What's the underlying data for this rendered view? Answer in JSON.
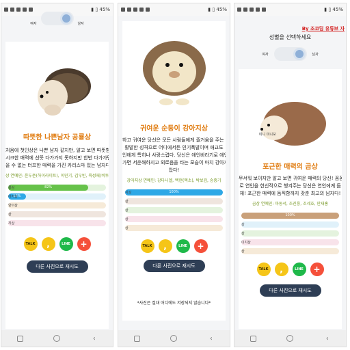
{
  "status": {
    "panel1_right": "▮ ▯ 45%",
    "panel2_right": "▮ ▯ 45%",
    "panel3_right": "▮ ▯ 45%"
  },
  "panel1": {
    "gender_left": "여자",
    "gender_right": "남자",
    "result_title": "따뜻한 나쁜남자 공룡상",
    "desc_lines": [
      "처음에 첫인상은 나쁜 남자 같지만, 알고 보면 따뜻함이",
      "시크한 매력에 선뜻 다가가지 못하지만 한번 다가가면",
      "을 수 없는 터프한 매력을 가진 카리스마 있는 남자다."
    ],
    "celeb": "상 연예인: 윤두준(하이라이트), 이민기, 김우빈, 육성재(비투비)...",
    "bars": [
      {
        "label": "룡상",
        "value": "82%",
        "percent": 82,
        "fill": "#66c24a",
        "track": "#e4f3de"
      },
      {
        "label": "아지상",
        "value": "18%",
        "percent": 18,
        "fill": "#2ea8e6",
        "track": "#e0f1fa"
      },
      {
        "label": "양이상",
        "value": "",
        "percent": 0,
        "fill": "#e0a65a",
        "track": "#f6ead8"
      },
      {
        "label": "상",
        "value": "",
        "percent": 0,
        "fill": "#c9a07a",
        "track": "#efe5de"
      },
      {
        "label": "끼상",
        "value": "",
        "percent": 0,
        "fill": "#e88aa5",
        "track": "#f8e3ea"
      }
    ],
    "share": {
      "kakao": "TALK",
      "comma": ",",
      "line": "LINE",
      "plus": "+"
    },
    "retry": "다른 사진으로 재시도"
  },
  "panel2": {
    "result_title": "귀여운 순둥이 강아지상",
    "desc_lines": [
      "하고 귀여운 당신은 모든 사람들에게 즐거움을 주는 3",
      "활발한 성격으로 어디에서든 인기폭발이며 애교도",
      "인에게 특히나 사랑스럽다. 당신은 애인바라기로 애인",
      "가면 서운해하지고 외로움을 타는 모습이 마치 강아지",
      "았다!"
    ],
    "celeb": "강아지상 연예인: 강다니엘, 백현(엑소), 박보검, 송중기",
    "bars": [
      {
        "label": "지상",
        "value": "100%",
        "percent": 100,
        "fill": "#2ea8e6",
        "track": "#e0f1fa"
      },
      {
        "label": "상",
        "value": "",
        "percent": 0,
        "fill": "#c9a07a",
        "track": "#efe5de"
      },
      {
        "label": "상",
        "value": "",
        "percent": 0,
        "fill": "#66c24a",
        "track": "#e4f3de"
      },
      {
        "label": "상",
        "value": "",
        "percent": 0,
        "fill": "#e88aa5",
        "track": "#f8e3ea"
      },
      {
        "label": "상",
        "value": "",
        "percent": 0,
        "fill": "#e0a65a",
        "track": "#f6ead8"
      }
    ],
    "share": {
      "kakao": "TALK",
      "comma": ",",
      "line": "LINE",
      "plus": "+"
    },
    "retry": "다른 사진으로 재시도",
    "disclaimer": "*사진은 절대 어디에도 저장되지 않습니다*"
  },
  "panel3": {
    "brand": "By 조코딩 유튜브 자",
    "gender_prompt": "성별을 선택하세요",
    "gender_left": "여자",
    "gender_right": "남자",
    "result_title": "포근한 매력의 곰상",
    "desc_lines": [
      "무서워 보이지만 알고 보면 귀여운 매력의 당신! 꼼꼼",
      "로 연인을 헌신적으로 챙겨주는 당신은 연인에게 듬",
      "재! 포근한 매력에 듬직함까지 갖춘 최고의 남자다!"
    ],
    "celeb": "곰상 연예인: 마동석, 조진웅, 조세호, 안재홍",
    "bars": [
      {
        "label": "",
        "value": "100%",
        "percent": 100,
        "fill": "#c9a07a",
        "track": "#efe5de"
      },
      {
        "label": "상",
        "value": "",
        "percent": 0,
        "fill": "#2ea8e6",
        "track": "#e0f1fa"
      },
      {
        "label": "상",
        "value": "",
        "percent": 0,
        "fill": "#66c24a",
        "track": "#e4f3de"
      },
      {
        "label": "이지상",
        "value": "",
        "percent": 0,
        "fill": "#e88aa5",
        "track": "#f8e3ea"
      },
      {
        "label": "상",
        "value": "",
        "percent": 0,
        "fill": "#e0a65a",
        "track": "#f6ead8"
      }
    ],
    "share": {
      "kakao": "TALK",
      "comma": ",",
      "line": "LINE",
      "plus": "+"
    },
    "retry": "다른 사진으로 재시도",
    "sketch_label": "미니 미니보"
  }
}
